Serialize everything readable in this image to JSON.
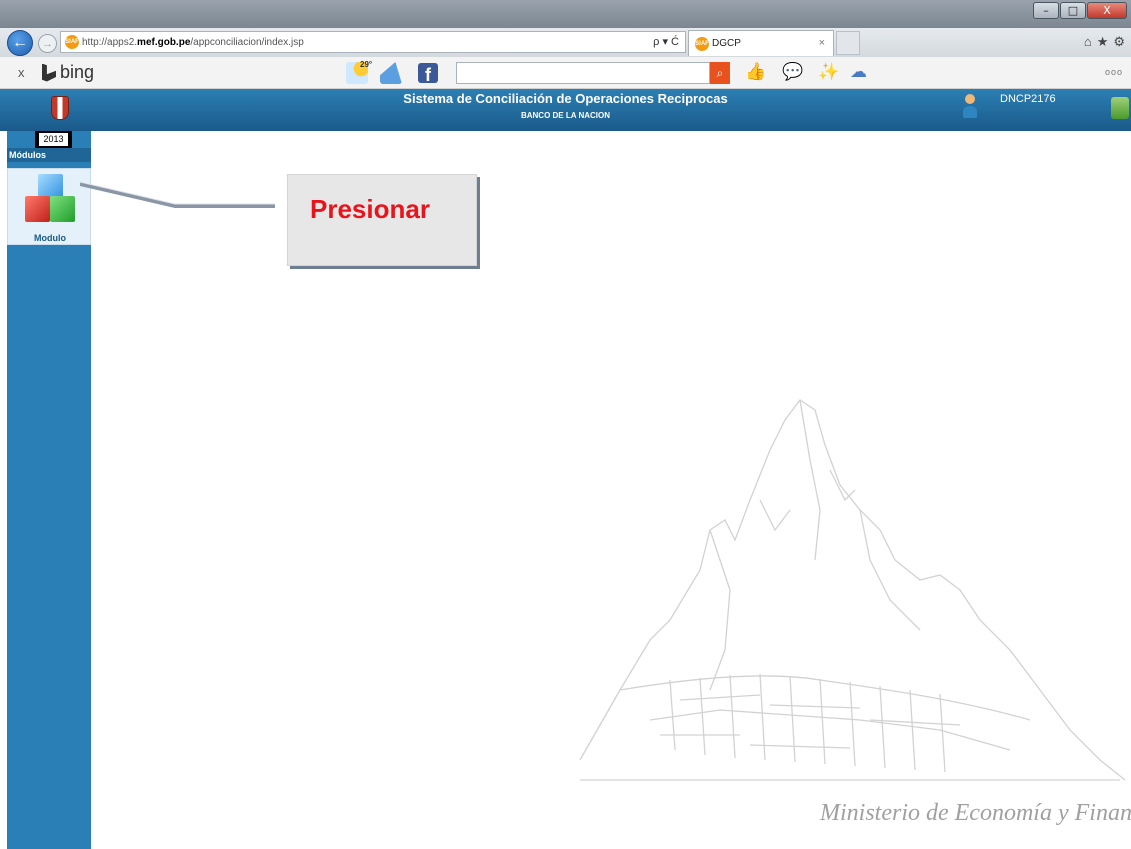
{
  "window": {
    "minimize": "–",
    "maximize": "□",
    "close": "X"
  },
  "browser": {
    "url_prefix": "http://apps2.",
    "url_domain": "mef.gob.pe",
    "url_path": "/appconciliacion/index.jsp",
    "url_actions": "ρ ▾ Ć",
    "tab_title": "DGCP",
    "tab_close": "×",
    "favicon_text": "SIAF",
    "icons": [
      "home-icon",
      "star-icon",
      "gear-icon"
    ]
  },
  "bing_toolbar": {
    "close": "x",
    "logo_text": "bing",
    "temperature": "29°",
    "search_value": "",
    "more": "ooo"
  },
  "app": {
    "title": "Sistema de Conciliación de Operaciones Reciprocas",
    "subtitle": "BANCO DE LA NACION",
    "username": "DNCP2176"
  },
  "sidebar": {
    "year": "2013",
    "modules_heading": "Módulos",
    "items": [
      {
        "label": "Modulo",
        "icon": "cubes-icon"
      }
    ]
  },
  "callout": {
    "text": "Presionar"
  },
  "watermark": {
    "text": "Ministerio de Economía y Finanzas"
  },
  "colors": {
    "header": "#1f6a9c",
    "sidebar": "#2a80b6",
    "callout_text": "#e8141b",
    "callout_bg": "#e7e7e7"
  }
}
